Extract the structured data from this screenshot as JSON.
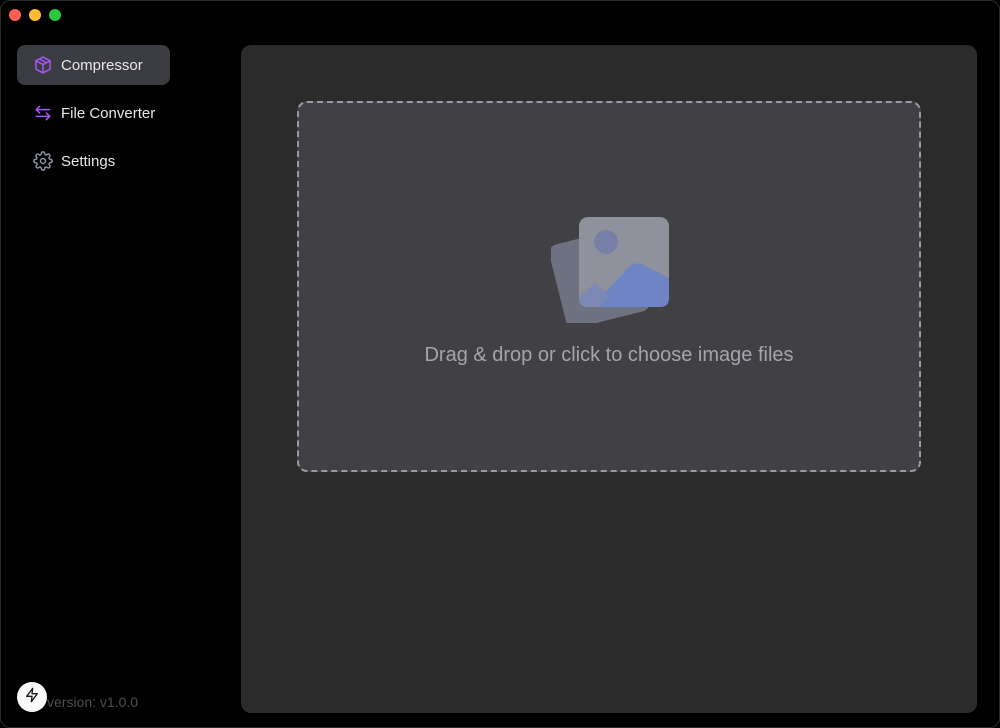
{
  "window": {
    "controls": [
      "close",
      "minimize",
      "maximize"
    ]
  },
  "sidebar": {
    "items": [
      {
        "label": "Compressor",
        "icon": "package-icon",
        "active": true
      },
      {
        "label": "File Converter",
        "icon": "arrows-swap-icon",
        "active": false
      },
      {
        "label": "Settings",
        "icon": "gear-icon",
        "active": false
      }
    ],
    "version": "version: v1.0.0"
  },
  "dropzone": {
    "text": "Drag & drop or click to choose image files",
    "icon": "images-icon"
  },
  "colors": {
    "accent": "#a855f7",
    "sidebar_active_bg": "#3b3c41",
    "panel_bg": "#2b2b2b",
    "dropzone_bg": "#404045",
    "image_blue": "#6f84c4"
  }
}
